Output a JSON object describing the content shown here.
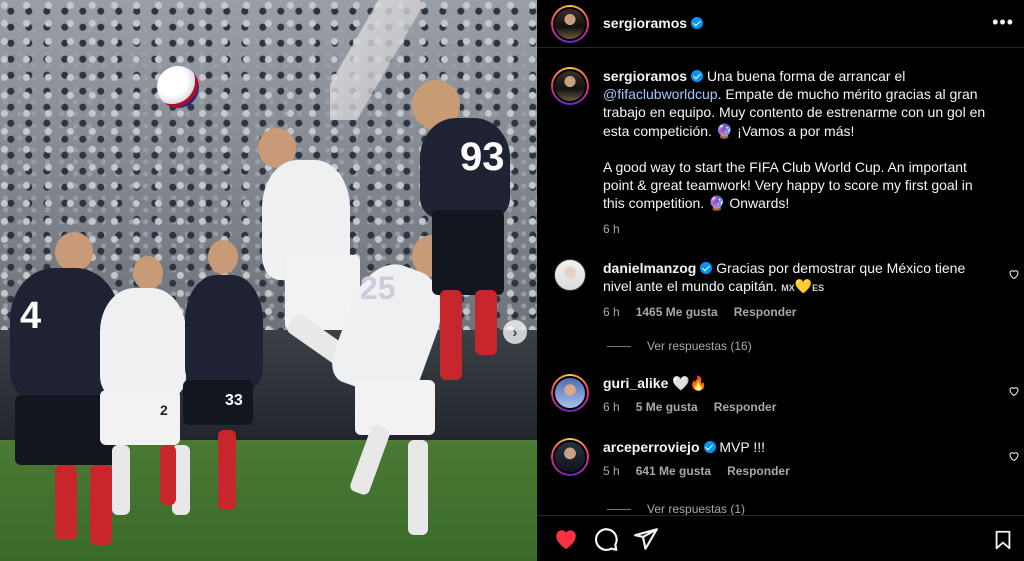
{
  "post": {
    "author": "sergioramos",
    "author_verified": true,
    "caption_lines": [
      "Una buena forma de arrancar el",
      "@fifaclubworldcup",
      ". Empate de mucho mérito gracias al gran trabajo en equipo. Muy contento de estrenarme con un gol en esta competición. 🔮 ¡Vamos a por más!"
    ],
    "caption_en": "A good way to start the FIFA Club World Cup. An important point & great teamwork! Very happy to score my first goal in this competition. 🔮 Onwards!",
    "time": "6 h",
    "media": {
      "jersey_numbers": [
        "4",
        "93",
        "33",
        "25",
        "2"
      ],
      "carousel_next": "›"
    }
  },
  "comments": [
    {
      "user": "danielmanzog",
      "verified": true,
      "text": "Gracias por demostrar que México tiene nivel ante el mundo capitán.",
      "flag_text": "MX",
      "emoji": "💛",
      "flag_text2": "ES",
      "time": "6 h",
      "likes": "1465 Me gusta",
      "reply": "Responder",
      "view_replies": "Ver respuestas (16)"
    },
    {
      "user": "guri_alike",
      "verified": false,
      "text": "🤍🔥",
      "time": "6 h",
      "likes": "5 Me gusta",
      "reply": "Responder"
    },
    {
      "user": "arceperroviejo",
      "verified": true,
      "text": "MVP !!!",
      "time": "5 h",
      "likes": "641 Me gusta",
      "reply": "Responder",
      "view_replies": "Ver respuestas (1)"
    }
  ],
  "icons": {
    "more": "more-options-icon",
    "like": "heart-filled-icon",
    "comment": "comment-icon",
    "share": "send-icon",
    "save": "bookmark-icon",
    "comment_like": "heart-outline-icon"
  },
  "colors": {
    "like_red": "#ff3040",
    "verified_blue": "#0095f6",
    "mention": "#a8c7fa",
    "secondary_text": "#a8a8a8"
  },
  "liked": true
}
